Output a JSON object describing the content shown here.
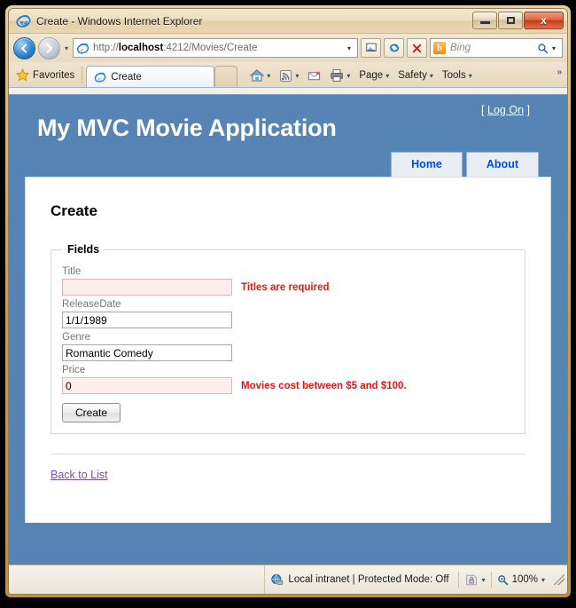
{
  "window": {
    "title": "Create - Windows Internet Explorer",
    "icon": "ie-logo-icon",
    "minimize_label": "Minimize",
    "restore_label": "Restore",
    "close_label": "x"
  },
  "navbar": {
    "back_label": "◀",
    "forward_label": "▶",
    "history_label": "▾",
    "url_prefix": "http://",
    "url_host": "localhost",
    "url_rest": ":4212/Movies/Create",
    "url_full": "http://localhost:4212/Movies/Create",
    "address_dropdown": "▾",
    "compat_label": "Compatibility View",
    "refresh_label": "Refresh",
    "stop_label": "✕",
    "search_engine": "Bing",
    "search_value": "Bing",
    "search_icon_letter": "b",
    "search_go_label": "⚲",
    "search_dropdown": "▾"
  },
  "tabbar": {
    "favorites_label": "Favorites",
    "tabs": [
      {
        "label": "Create",
        "icon": "ie-logo-icon",
        "active": true
      }
    ],
    "commands": [
      {
        "label": "",
        "icon": "home-icon",
        "has_caret": true
      },
      {
        "label": "",
        "icon": "rss-feed-icon",
        "has_caret": true
      },
      {
        "label": "",
        "icon": "mail-icon",
        "has_caret": false
      },
      {
        "label": "",
        "icon": "print-icon",
        "has_caret": true
      },
      {
        "label": "Page",
        "icon": "",
        "has_caret": true
      },
      {
        "label": "Safety",
        "icon": "",
        "has_caret": true
      },
      {
        "label": "Tools",
        "icon": "",
        "has_caret": true
      }
    ],
    "overflow_label": "»"
  },
  "site": {
    "title": "My MVC Movie Application",
    "logon_open_bracket": "[",
    "logon_label": "Log On",
    "logon_close_bracket": "]",
    "nav": [
      {
        "label": "Home"
      },
      {
        "label": "About"
      }
    ]
  },
  "page": {
    "heading": "Create",
    "fieldset_legend": "Fields",
    "fields": [
      {
        "label": "Title",
        "value": "",
        "placeholder": "",
        "invalid": true,
        "error": "Titles are required"
      },
      {
        "label": "ReleaseDate",
        "value": "1/1/1989",
        "placeholder": "",
        "invalid": false,
        "error": ""
      },
      {
        "label": "Genre",
        "value": "Romantic Comedy",
        "placeholder": "",
        "invalid": false,
        "error": ""
      },
      {
        "label": "Price",
        "value": "0",
        "placeholder": "",
        "invalid": true,
        "error": "Movies cost between $5 and $100."
      }
    ],
    "submit_label": "Create",
    "back_link_label": "Back to List"
  },
  "statusbar": {
    "zone_text": "Local intranet | Protected Mode: Off",
    "zone_icon": "intranet-globe-icon",
    "privacy_icon": "privacy-report-icon",
    "privacy_caret": "▾",
    "zoom_level": "100%",
    "zoom_icon": "magnifier-icon",
    "zoom_caret": "▾"
  },
  "colors": {
    "header_blue": "#5684b5",
    "nav_tab_bg": "#e8eef4",
    "nav_link_blue": "#034af3",
    "error_red": "#fa0f0f",
    "error_field_bg": "#fdeeee",
    "link_purple": "#7a4fb5"
  }
}
